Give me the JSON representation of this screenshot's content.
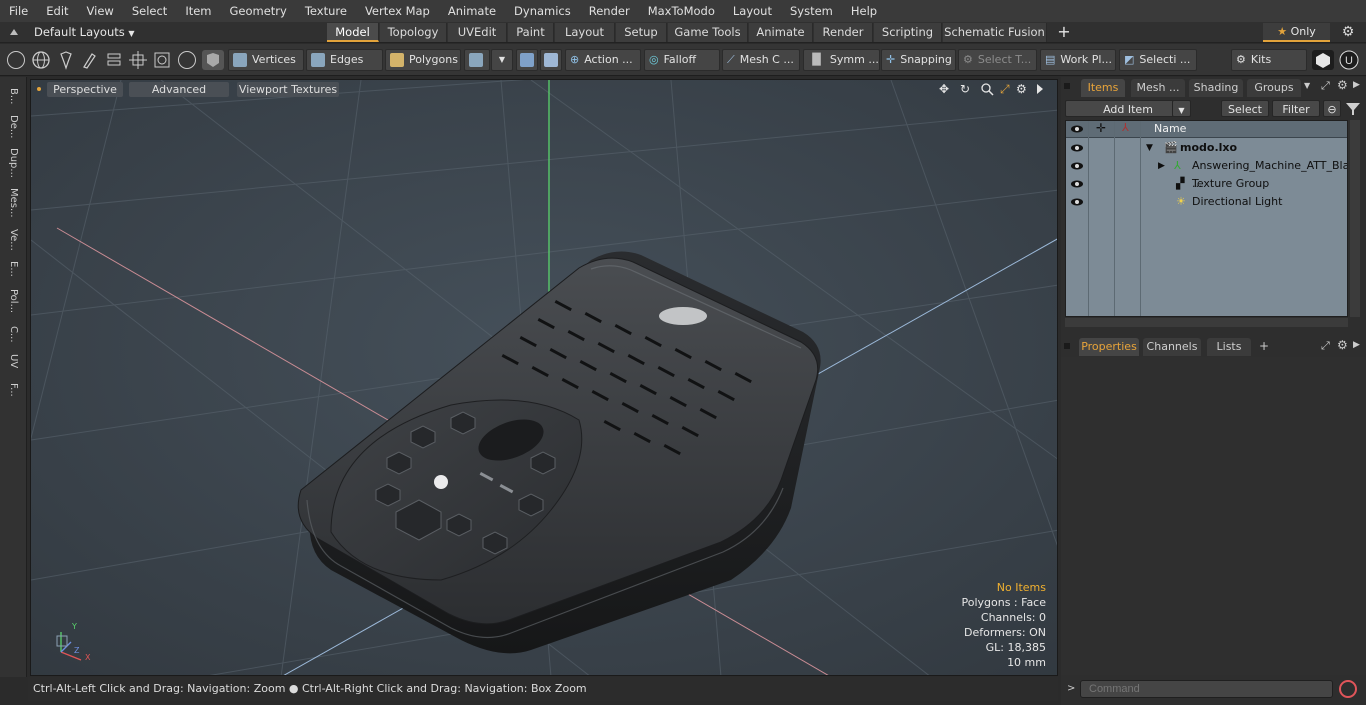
{
  "menubar": {
    "items": [
      "File",
      "Edit",
      "View",
      "Select",
      "Item",
      "Geometry",
      "Texture",
      "Vertex Map",
      "Animate",
      "Dynamics",
      "Render",
      "MaxToModo",
      "Layout",
      "System",
      "Help"
    ]
  },
  "layoutbar": {
    "preset": "Default Layouts",
    "tabs": [
      "Model",
      "Topology",
      "UVEdit",
      "Paint",
      "Layout",
      "Setup",
      "Game Tools",
      "Animate",
      "Render",
      "Scripting",
      "Schematic Fusion"
    ],
    "active_tab": "Model",
    "add_tab": "+",
    "only_label": "Only"
  },
  "toolbar": {
    "vertices": "Vertices",
    "edges": "Edges",
    "polygons": "Polygons",
    "action": "Action ...",
    "falloff": "Falloff",
    "mesh": "Mesh C ...",
    "symm": "Symm ...",
    "snapping": "Snapping",
    "select_t": "Select T...",
    "work_pl": "Work Pl...",
    "selecti": "Selecti ...",
    "kits": "Kits"
  },
  "leftstrip": {
    "tabs": [
      "B...",
      "De...",
      "Dup...",
      "Mes...",
      "Ve...",
      "E...",
      "Pol...",
      "C...",
      "UV",
      "F..."
    ]
  },
  "viewport": {
    "view_mode": "Perspective",
    "shading": "Advanced",
    "textures": "Viewport Textures",
    "info": {
      "no_items": "No Items",
      "polygons": "Polygons : Face",
      "channels": "Channels: 0",
      "deformers": "Deformers: ON",
      "gl": "GL: 18,385",
      "scale": "10 mm"
    },
    "axis": {
      "x": "X",
      "y": "Y",
      "z": "Z"
    }
  },
  "status": {
    "hint": "Ctrl-Alt-Left Click and Drag: Navigation: Zoom ● Ctrl-Alt-Right Click and Drag: Navigation: Box Zoom"
  },
  "items_panel": {
    "tabs": [
      "Items",
      "Mesh ...",
      "Shading",
      "Groups"
    ],
    "add_item": "Add Item",
    "select": "Select",
    "filter": "Filter",
    "column_name": "Name",
    "rows": [
      {
        "name": "modo.lxo"
      },
      {
        "name": "Answering_Machine_ATT_Bla ..."
      },
      {
        "name": "Texture Group"
      },
      {
        "name": "Directional Light"
      }
    ]
  },
  "properties_panel": {
    "tabs": [
      "Properties",
      "Channels",
      "Lists"
    ],
    "add": "+"
  },
  "command": {
    "placeholder": "Command"
  },
  "colors": {
    "accent": "#e2a33b",
    "viewport": "#3a4149",
    "tree_bg": "#7d8b96"
  }
}
